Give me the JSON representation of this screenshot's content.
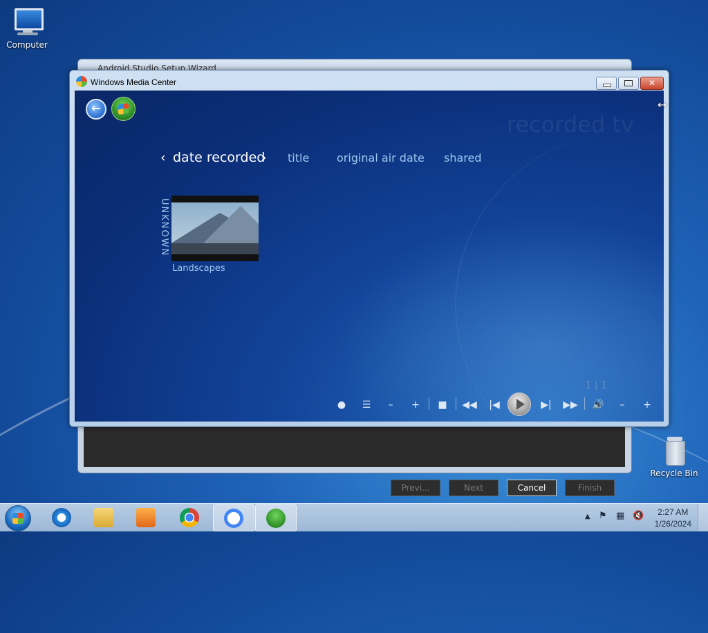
{
  "desktop": {
    "icons": [
      {
        "label": "Computer",
        "icon": "computer-icon"
      },
      {
        "label": "Recycle Bin",
        "icon": "recycle-bin-icon"
      }
    ]
  },
  "background_window": {
    "title": "Android Studio Setup Wizard",
    "buttons": {
      "previous": "Previ...",
      "next": "Next",
      "cancel": "Cancel",
      "finish": "Finish"
    }
  },
  "wmc": {
    "title": "Windows Media Center",
    "heading": "recorded tv",
    "pivots": {
      "prev_arrow": "‹",
      "selected": "date recorded",
      "next_arrow": "›",
      "items": [
        "title",
        "original air date",
        "shared"
      ]
    },
    "group_label": "UNKNOWN",
    "item": {
      "label": "Landscapes"
    },
    "pager": "1 | 1",
    "transport": [
      "record",
      "guide",
      "channel-down",
      "channel-up",
      "stop",
      "rewind",
      "previous",
      "play",
      "next",
      "fast-forward",
      "mute",
      "volume-down",
      "volume-up"
    ]
  },
  "taskbar": {
    "apps": [
      "internet-explorer-icon",
      "file-explorer-icon",
      "media-player-icon",
      "chrome-icon",
      "android-studio-icon",
      "media-center-icon"
    ],
    "clock_time": "2:27 AM",
    "clock_date": "1/26/2024"
  }
}
